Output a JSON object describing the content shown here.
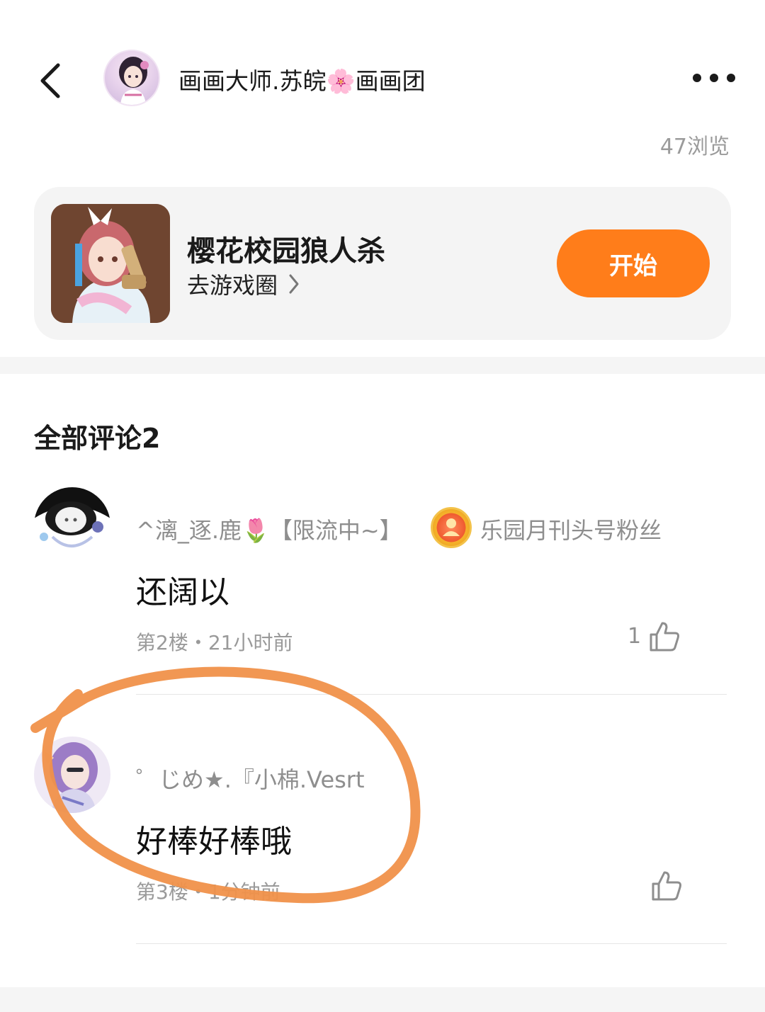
{
  "header": {
    "author_name_part1": "画画大师.苏皖",
    "author_name_emoji": "🌸",
    "author_name_part2": "画画团",
    "views": "47浏览"
  },
  "game_card": {
    "title": "樱花校园狼人杀",
    "link_label": "去游戏圈",
    "start_label": "开始",
    "accent_color": "#ff7d1a"
  },
  "comments": {
    "header": "全部评论2",
    "items": [
      {
        "username": "^漓_逐.鹿🌷【限流中~】",
        "badge_label": "乐园月刊头号粉丝",
        "text": "还阔以",
        "meta": "第2楼・21小时前",
        "likes": "1"
      },
      {
        "username": "゜じめ★.『小棉.Vesrt",
        "text": "好棒好棒哦",
        "meta": "第3楼・1分钟前",
        "likes": ""
      }
    ]
  },
  "annotation": {
    "color": "#f0914a"
  }
}
